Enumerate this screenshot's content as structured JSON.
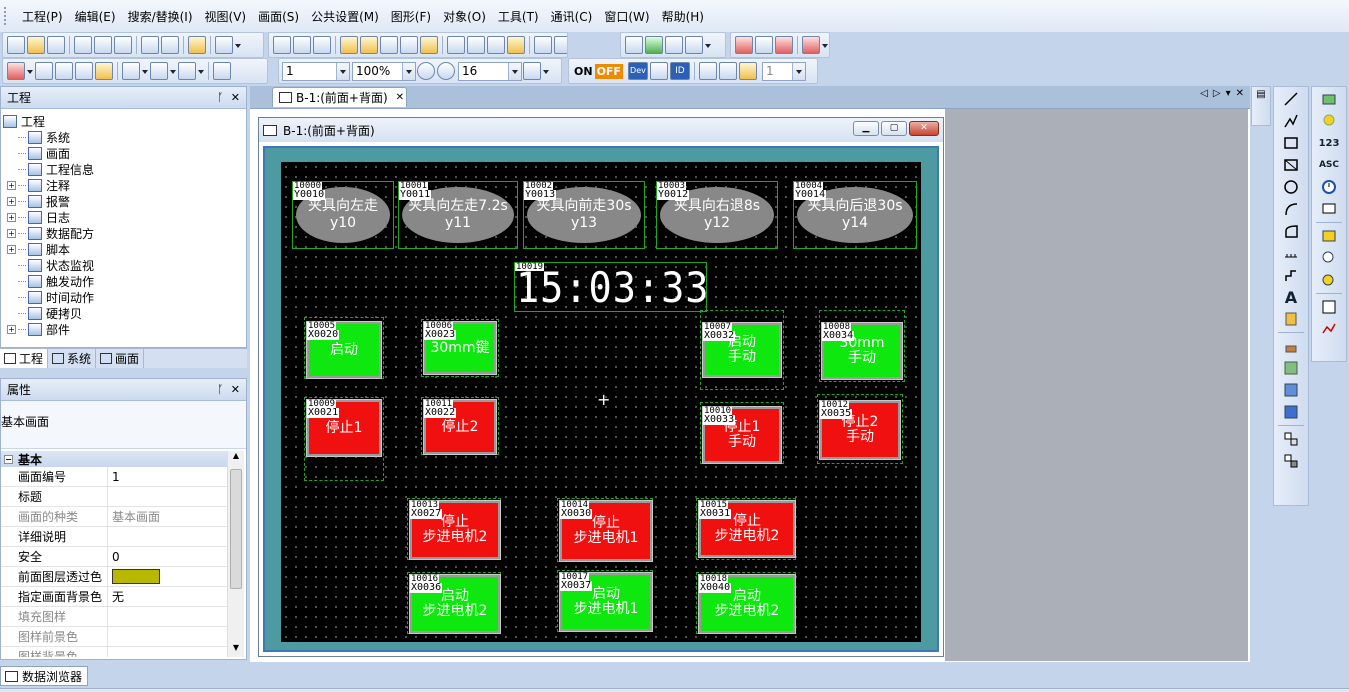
{
  "menu": [
    "工程(P)",
    "编辑(E)",
    "搜索/替换(I)",
    "视图(V)",
    "画面(S)",
    "公共设置(M)",
    "图形(F)",
    "对象(O)",
    "工具(T)",
    "通讯(C)",
    "窗口(W)",
    "帮助(H)"
  ],
  "toolbar": {
    "combo_page": "1",
    "combo_zoom": "100%",
    "combo_grid": "16",
    "on_label": "ON",
    "off_label": "OFF",
    "combo_layer": "1",
    "dev_label": "Dev",
    "id_label": "ID"
  },
  "project_panel": {
    "title": "工程",
    "items": [
      {
        "label": "工程",
        "level": 0,
        "expand": ""
      },
      {
        "label": "系统",
        "level": 1,
        "expand": ""
      },
      {
        "label": "画面",
        "level": 1,
        "expand": ""
      },
      {
        "label": "工程信息",
        "level": 1,
        "expand": ""
      },
      {
        "label": "注释",
        "level": 1,
        "expand": "+"
      },
      {
        "label": "报警",
        "level": 1,
        "expand": "+"
      },
      {
        "label": "日志",
        "level": 1,
        "expand": "+"
      },
      {
        "label": "数据配方",
        "level": 1,
        "expand": "+"
      },
      {
        "label": "脚本",
        "level": 1,
        "expand": "+"
      },
      {
        "label": "状态监视",
        "level": 1,
        "expand": ""
      },
      {
        "label": "触发动作",
        "level": 1,
        "expand": ""
      },
      {
        "label": "时间动作",
        "level": 1,
        "expand": ""
      },
      {
        "label": "硬拷贝",
        "level": 1,
        "expand": ""
      },
      {
        "label": "部件",
        "level": 1,
        "expand": "+"
      }
    ],
    "tabs": [
      "工程",
      "系统",
      "画面"
    ]
  },
  "properties_panel": {
    "title": "属性",
    "subtitle": "基本画面",
    "section": "基本",
    "rows": [
      {
        "key": "画面编号",
        "value": "1",
        "dim": false
      },
      {
        "key": "标题",
        "value": "",
        "dim": false
      },
      {
        "key": "画面的种类",
        "value": "基本画面",
        "dim": true
      },
      {
        "key": "详细说明",
        "value": "",
        "dim": false
      },
      {
        "key": "安全",
        "value": "0",
        "dim": false
      },
      {
        "key": "前面图层透过色",
        "value": "",
        "dim": false,
        "swatch": "#b8b800"
      },
      {
        "key": "指定画面背景色",
        "value": "无",
        "dim": false
      },
      {
        "key": "填充图样",
        "value": "",
        "dim": true
      },
      {
        "key": "图样前景色",
        "value": "",
        "dim": true
      },
      {
        "key": "图样背景色",
        "value": "",
        "dim": true
      }
    ]
  },
  "doc_tab": "B-1:(前面+背面)",
  "screen_window_title": "B-1:(前面+背面)",
  "clock": {
    "id": "10019",
    "time": "15:03:33"
  },
  "lamps": [
    {
      "id": "10000",
      "addr": "Y0010",
      "l1": "夹具向左走",
      "l2": "y10"
    },
    {
      "id": "10001",
      "addr": "Y0011",
      "l1": "夹具向左走7.2s",
      "l2": "y11"
    },
    {
      "id": "10002",
      "addr": "Y0013",
      "l1": "夹具向前走30s",
      "l2": "y13"
    },
    {
      "id": "10003",
      "addr": "Y0012",
      "l1": "夹具向右退8s",
      "l2": "y12"
    },
    {
      "id": "10004",
      "addr": "Y0014",
      "l1": "夹具向后退30s",
      "l2": "y14"
    }
  ],
  "buttons": [
    {
      "id": "10005",
      "addr": "X0020",
      "l1": "启动",
      "l2": "",
      "color": "g"
    },
    {
      "id": "10006",
      "addr": "X0023",
      "l1": "30mm键",
      "l2": "",
      "color": "g"
    },
    {
      "id": "10007",
      "addr": "X0032",
      "l1": "启动",
      "l2": "手动",
      "color": "g"
    },
    {
      "id": "10008",
      "addr": "X0034",
      "l1": "30mm",
      "l2": "手动",
      "color": "g"
    },
    {
      "id": "10009",
      "addr": "X0021",
      "l1": "停止1",
      "l2": "",
      "color": "r"
    },
    {
      "id": "10011",
      "addr": "X0022",
      "l1": "停止2",
      "l2": "",
      "color": "r"
    },
    {
      "id": "10010",
      "addr": "X0033",
      "l1": "停止1",
      "l2": "手动",
      "color": "r"
    },
    {
      "id": "10012",
      "addr": "X0035",
      "l1": "停止2",
      "l2": "手动",
      "color": "r"
    },
    {
      "id": "10013",
      "addr": "X0027",
      "l1": "停止",
      "l2": "步进电机2",
      "color": "r"
    },
    {
      "id": "10014",
      "addr": "X0030",
      "l1": "停止",
      "l2": "步进电机1",
      "color": "r"
    },
    {
      "id": "10015",
      "addr": "X0031",
      "l1": "停止",
      "l2": "步进电机2",
      "color": "r"
    },
    {
      "id": "10016",
      "addr": "X0036",
      "l1": "启动",
      "l2": "步进电机2",
      "color": "g"
    },
    {
      "id": "10017",
      "addr": "X0037",
      "l1": "启动",
      "l2": "步进电机1",
      "color": "g"
    },
    {
      "id": "10018",
      "addr": "X0040",
      "l1": "启动",
      "l2": "步进电机2",
      "color": "g"
    }
  ],
  "bottom_tab": "数据浏览器"
}
